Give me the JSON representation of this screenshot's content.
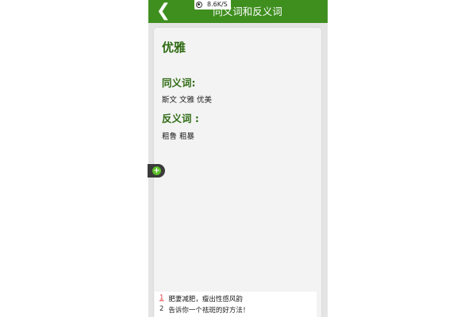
{
  "status": {
    "speed": "8.6K/S"
  },
  "header": {
    "title": "同义词和反义词",
    "back_icon": "chevron-left-icon"
  },
  "entry": {
    "word": "优雅",
    "synonyms_heading": "同义词:",
    "synonyms": "斯文 文雅 优美",
    "antonyms_heading": "反义词 :",
    "antonyms": "粗鲁 粗暴"
  },
  "fab": {
    "symbol": "+"
  },
  "ad_list": [
    {
      "num": "1",
      "text": "肥妻减肥，瘦出性感风韵"
    },
    {
      "num": "2",
      "text": "告诉你一个祛斑的好方法！"
    }
  ],
  "colors": {
    "header": "#3f8f1f",
    "heading_text": "#2f6b14",
    "fab": "#5cbf2a"
  }
}
